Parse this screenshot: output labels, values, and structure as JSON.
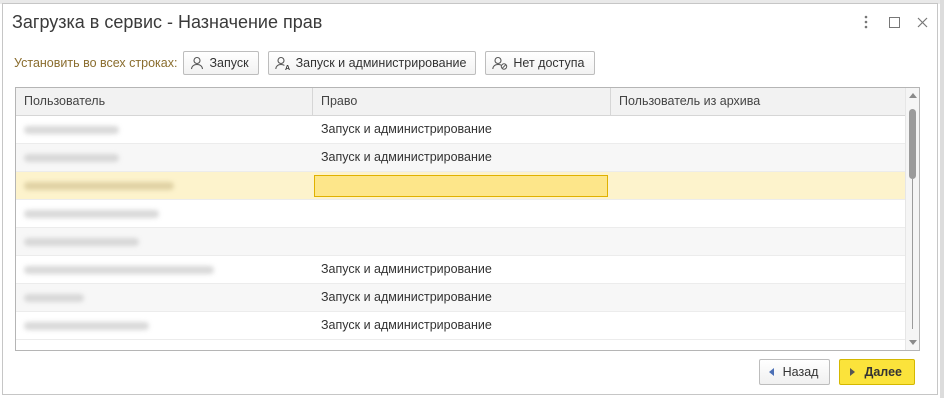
{
  "window": {
    "title": "Загрузка в сервис - Назначение прав"
  },
  "toolbar": {
    "label": "Установить во всех строках:",
    "buttons": [
      {
        "label": "Запуск",
        "icon": "user-icon"
      },
      {
        "label": "Запуск и администрирование",
        "icon": "user-admin-icon"
      },
      {
        "label": "Нет доступа",
        "icon": "user-blocked-icon"
      }
    ]
  },
  "table": {
    "columns": [
      "Пользователь",
      "Право",
      "Пользователь из архива"
    ],
    "rows": [
      {
        "user": "",
        "right": "Запуск и администрирование",
        "archive": "",
        "user_blurred": true
      },
      {
        "user": "",
        "right": "Запуск и администрирование",
        "archive": "",
        "user_blurred": true
      },
      {
        "user": "",
        "right": "",
        "archive": "",
        "user_blurred": true,
        "selected": true
      },
      {
        "user": "",
        "right": "",
        "archive": "",
        "user_blurred": true
      },
      {
        "user": "",
        "right": "",
        "archive": "",
        "user_blurred": true
      },
      {
        "user": "",
        "right": "Запуск и администрирование",
        "archive": "",
        "user_blurred": true
      },
      {
        "user": "",
        "right": "Запуск и администрирование",
        "archive": "",
        "user_blurred": true
      },
      {
        "user": "",
        "right": "Запуск и администрирование",
        "archive": "",
        "user_blurred": true
      }
    ]
  },
  "footer": {
    "back_label": "Назад",
    "next_label": "Далее"
  },
  "colors": {
    "accent": "#fbe33b",
    "selected_row": "#fdf3cc",
    "selected_cell": "#fde68a",
    "toolbar_label": "#8a6d2e"
  }
}
